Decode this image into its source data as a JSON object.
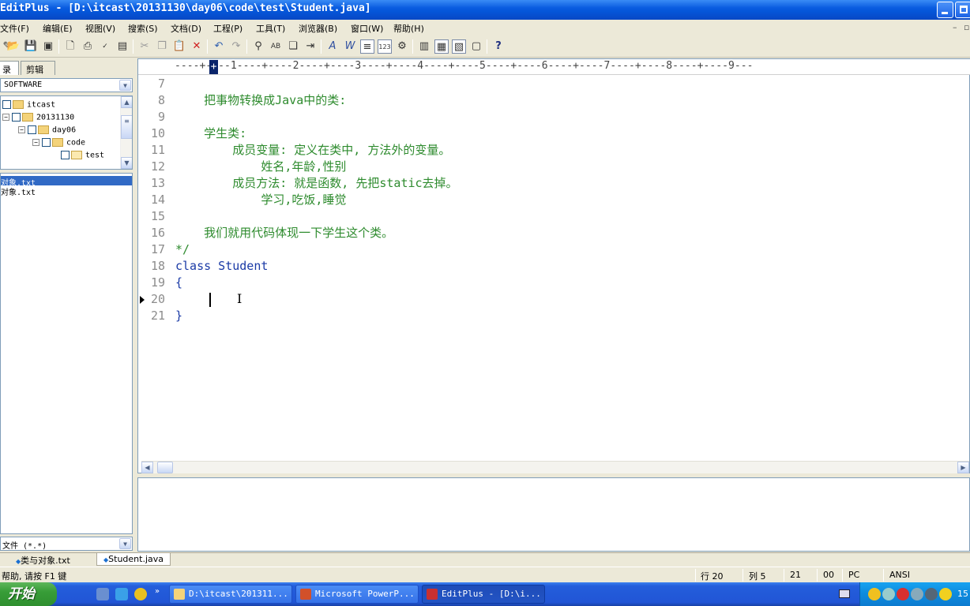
{
  "window": {
    "title": "EditPlus - [D:\\itcast\\20131130\\day06\\code\\test\\Student.java]"
  },
  "menu": [
    "文件(F)",
    "编辑(E)",
    "视图(V)",
    "搜索(S)",
    "文档(D)",
    "工程(P)",
    "工具(T)",
    "浏览器(B)",
    "窗口(W)",
    "帮助(H)"
  ],
  "left_panel": {
    "tabs": [
      "录",
      "剪辑"
    ],
    "drive": "SOFTWARE",
    "tree": [
      {
        "label": "itcast",
        "level": 0
      },
      {
        "label": "20131130",
        "level": 1
      },
      {
        "label": "day06",
        "level": 2
      },
      {
        "label": "code",
        "level": 3
      },
      {
        "label": "test",
        "level": 4
      }
    ],
    "files": [
      {
        "name": "对象.txt",
        "selected": true
      },
      {
        "name": "对象.txt",
        "selected": false
      }
    ],
    "filter": "文件 (*.*)"
  },
  "editor": {
    "ruler": "----+----1----+----2----+----3----+----4----+----5----+----6----+----7----+----8----+----9---",
    "ruler_cursor": "+",
    "lines": [
      {
        "no": "7",
        "text": "",
        "style": "comment"
      },
      {
        "no": "8",
        "text": "    把事物转换成Java中的类:",
        "style": "comment"
      },
      {
        "no": "9",
        "text": "",
        "style": "comment"
      },
      {
        "no": "10",
        "text": "    学生类:",
        "style": "comment"
      },
      {
        "no": "11",
        "text": "        成员变量: 定义在类中, 方法外的变量。",
        "style": "comment"
      },
      {
        "no": "12",
        "text": "            姓名,年龄,性别",
        "style": "comment"
      },
      {
        "no": "13",
        "text": "        成员方法: 就是函数, 先把static去掉。",
        "style": "comment"
      },
      {
        "no": "14",
        "text": "            学习,吃饭,睡觉",
        "style": "comment"
      },
      {
        "no": "15",
        "text": "",
        "style": "comment"
      },
      {
        "no": "16",
        "text": "    我们就用代码体现一下学生这个类。",
        "style": "comment"
      },
      {
        "no": "17",
        "text": "*/",
        "style": "comment"
      },
      {
        "no": "18",
        "text": "class Student",
        "style": "plain"
      },
      {
        "no": "19",
        "text": "{",
        "style": "plain"
      },
      {
        "no": "20",
        "text": "",
        "style": "plain"
      },
      {
        "no": "21",
        "text": "}",
        "style": "plain"
      }
    ]
  },
  "doc_tabs": [
    {
      "label": "类与对象.txt",
      "active": false
    },
    {
      "label": "Student.java",
      "active": true
    }
  ],
  "status": {
    "help": "帮助, 请按 F1 键",
    "line": "行 20",
    "col": "列 5",
    "num": "21",
    "code": "00",
    "mode": "PC",
    "encoding": "ANSI"
  },
  "taskbar": {
    "start": "开始",
    "tasks": [
      {
        "label": "D:\\itcast\\201311...",
        "active": false
      },
      {
        "label": "Microsoft PowerP...",
        "active": false
      },
      {
        "label": "EditPlus - [D:\\i...",
        "active": true
      }
    ],
    "clock": "15"
  },
  "colors": {
    "comment": "#2e8b2e",
    "keyword": "#1a3aa6",
    "selection": "#316ac5"
  }
}
